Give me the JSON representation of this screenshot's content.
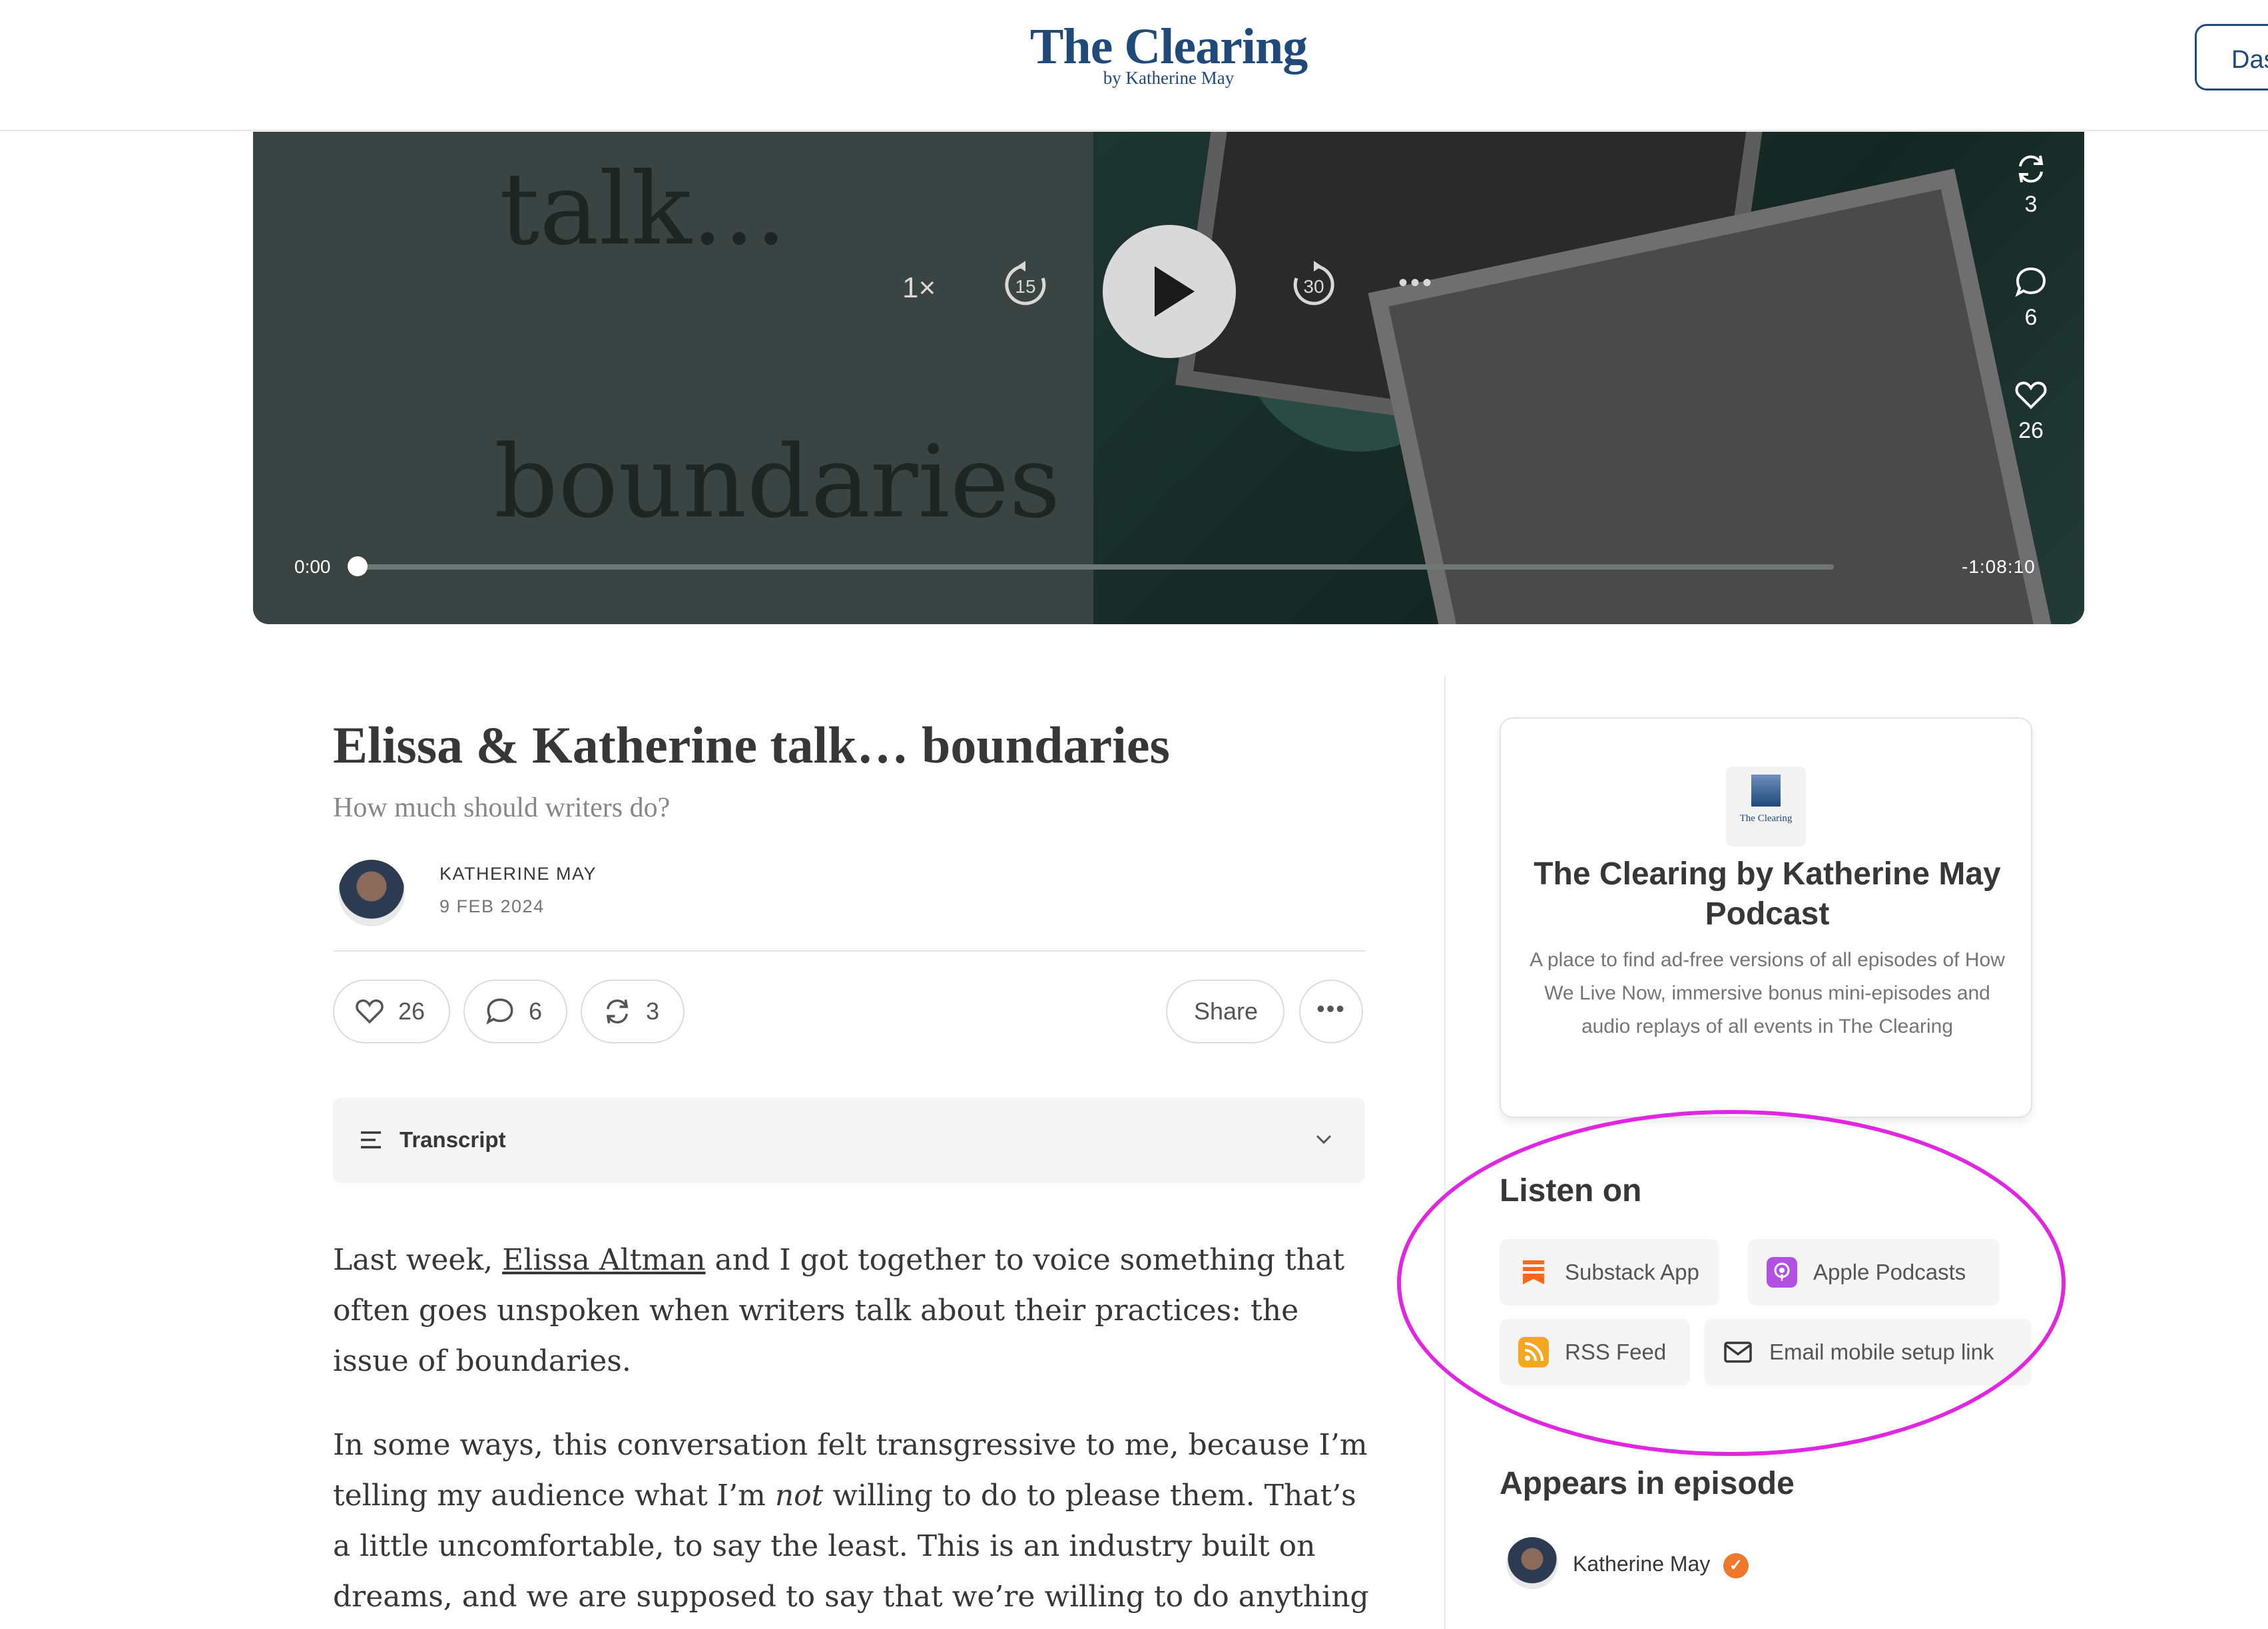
{
  "header": {
    "logo_title": "The Clearing",
    "logo_subtitle": "by Katherine May",
    "dashboard_label": "Das"
  },
  "player": {
    "text_top": "talk...",
    "text_bottom": "boundaries",
    "speed": "1×",
    "skip_back": "15",
    "skip_forward": "30",
    "more": "•••",
    "restacks": "3",
    "comments": "6",
    "likes": "26",
    "time_elapsed": "0:00",
    "time_remaining": "-1:08:10",
    "progress_fraction": 0
  },
  "article": {
    "title": "Elissa & Katherine talk… boundaries",
    "subtitle": "How much should writers do?",
    "author": "KATHERINE MAY",
    "date": "9 FEB 2024",
    "likes": "26",
    "comments": "6",
    "restacks": "3",
    "share_label": "Share",
    "more_label": "•••",
    "transcript_label": "Transcript",
    "p1_a": "Last week, ",
    "p1_link": "Elissa Altman",
    "p1_b": " and I got together to voice something that often goes unspoken when writers talk about their practices: the issue of boundaries.",
    "p2_a": "In some ways, this conversation felt transgressive to me, because I’m telling my audience what I’m ",
    "p2_em": "not",
    "p2_b": " willing to do to please them. That’s a little uncomfortable, to say the least. This is an industry built on dreams, and we are supposed to say that we’re willing to do anything to be here."
  },
  "sidebar": {
    "logo_text": "The Clearing",
    "podcast_title": "The Clearing by Katherine May Podcast",
    "podcast_desc": "A place to find ad-free versions of all episodes of How We Live Now, immersive bonus mini-episodes and audio replays of all events in The Clearing",
    "listen_heading": "Listen on",
    "listen_options": [
      "Substack App",
      "Apple Podcasts",
      "RSS Feed",
      "Email mobile setup link"
    ],
    "appears_heading": "Appears in episode",
    "guest_name": "Katherine May",
    "verified_mark": "✓"
  },
  "colors": {
    "brand_blue": "#1f4a7a",
    "annotation_magenta": "#e026e0",
    "substack_orange": "#ff6719",
    "apple_purple": "#b150e2",
    "rss_orange": "#f5a623"
  },
  "icons": [
    "repeat-icon",
    "comment-icon",
    "heart-icon",
    "play-icon",
    "rewind-15-icon",
    "forward-30-icon",
    "transcript-lines-icon",
    "chevron-down-icon",
    "substack-icon",
    "apple-podcasts-icon",
    "rss-icon",
    "mail-icon",
    "verified-icon"
  ]
}
